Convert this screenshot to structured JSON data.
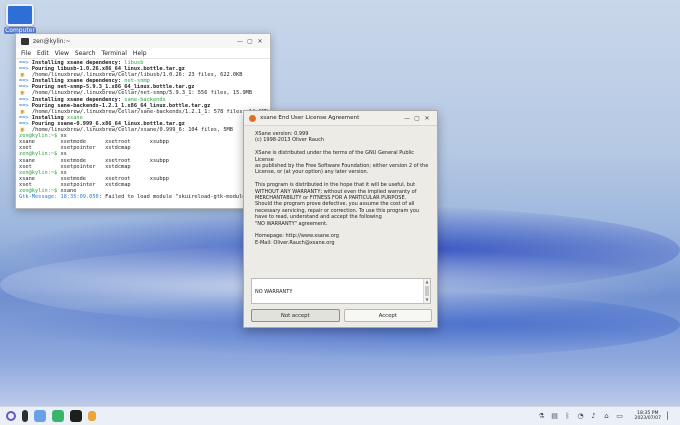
{
  "desktop": {
    "icon_label": "Computer"
  },
  "terminal": {
    "title": "zen@kylin:~",
    "menu": [
      "File",
      "Edit",
      "View",
      "Search",
      "Terminal",
      "Help"
    ],
    "lines": [
      [
        {
          "t": "==> ",
          "c": "arrow"
        },
        {
          "t": "Installing xsane dependency: ",
          "c": "bold"
        },
        {
          "t": "libusb",
          "c": "green"
        }
      ],
      [
        {
          "t": "==> ",
          "c": "arrow"
        },
        {
          "t": "Pouring libusb-1.0.26.x86_64_linux.bottle.tar.gz",
          "c": "bold"
        }
      ],
      [
        {
          "t": "🍺  ",
          "c": ""
        },
        {
          "t": "/home/linuxbrew/.linuxbrew/Cellar/libusb/1.0.26: 23 files, 622.0KB",
          "c": ""
        }
      ],
      [
        {
          "t": "==> ",
          "c": "arrow"
        },
        {
          "t": "Installing xsane dependency: ",
          "c": "bold"
        },
        {
          "t": "net-snmp",
          "c": "green"
        }
      ],
      [
        {
          "t": "==> ",
          "c": "arrow"
        },
        {
          "t": "Pouring net-snmp-5.9.3_1.x86_64_linux.bottle.tar.gz",
          "c": "bold"
        }
      ],
      [
        {
          "t": "🍺  ",
          "c": ""
        },
        {
          "t": "/home/linuxbrew/.linuxbrew/Cellar/net-snmp/5.9.3_1: 556 files, 15.9MB",
          "c": ""
        }
      ],
      [
        {
          "t": "==> ",
          "c": "arrow"
        },
        {
          "t": "Installing xsane dependency: ",
          "c": "bold"
        },
        {
          "t": "sane-backends",
          "c": "green"
        }
      ],
      [
        {
          "t": "==> ",
          "c": "arrow"
        },
        {
          "t": "Pouring sane-backends-1.2.1_1.x86_64_linux.bottle.tar.gz",
          "c": "bold"
        }
      ],
      [
        {
          "t": "🍺  ",
          "c": ""
        },
        {
          "t": "/home/linuxbrew/.linuxbrew/Cellar/sane-backends/1.2.1_1: 578 files, 14.1MB",
          "c": ""
        }
      ],
      [
        {
          "t": "==> ",
          "c": "arrow"
        },
        {
          "t": "Installing ",
          "c": "bold"
        },
        {
          "t": "xsane",
          "c": "green"
        }
      ],
      [
        {
          "t": "==> ",
          "c": "arrow"
        },
        {
          "t": "Pouring xsane-0.999_6.x86_64_linux.bottle.tar.gz",
          "c": "bold"
        }
      ],
      [
        {
          "t": "🍺  ",
          "c": ""
        },
        {
          "t": "/home/linuxbrew/.linuxbrew/Cellar/xsane/0.999_6: 104 files, 5MB",
          "c": ""
        }
      ],
      [
        {
          "t": "zen@kylin:~$ ",
          "c": "green"
        },
        {
          "t": "xs",
          "c": ""
        }
      ],
      [
        {
          "t": "xsane        xsetmode      xsetroot      xsubpp",
          "c": ""
        }
      ],
      [
        {
          "t": "xset         xsetpointer   xstdcmap",
          "c": ""
        }
      ],
      [
        {
          "t": "zen@kylin:~$ ",
          "c": "green"
        },
        {
          "t": "xs",
          "c": ""
        }
      ],
      [
        {
          "t": "xsane        xsetmode      xsetroot      xsubpp",
          "c": ""
        }
      ],
      [
        {
          "t": "xset         xsetpointer   xstdcmap",
          "c": ""
        }
      ],
      [
        {
          "t": "zen@kylin:~$ ",
          "c": "green"
        },
        {
          "t": "xs",
          "c": ""
        }
      ],
      [
        {
          "t": "xsane        xsetmode      xsetroot      xsubpp",
          "c": ""
        }
      ],
      [
        {
          "t": "xset         xsetpointer   xstdcmap",
          "c": ""
        }
      ],
      [
        {
          "t": "zen@kylin:~$ ",
          "c": "green"
        },
        {
          "t": "xsane",
          "c": ""
        }
      ],
      [
        {
          "t": "Gtk-Message: ",
          "c": "blue"
        },
        {
          "t": "18:35:09.050",
          "c": "blue"
        },
        {
          "t": ": Failed to load module \"skuireload-gtk-module\"",
          "c": ""
        }
      ]
    ]
  },
  "dialog": {
    "title": "xsane End User License Agreement",
    "paragraphs": [
      [
        "XSane version: 0.999",
        "(c) 1998-2013 Oliver Rauch"
      ],
      [
        "XSane is distributed under the terms of the GNU General Public License",
        "as published by the Free Software Foundation; either version 2 of the",
        "License, or (at your option) any later version."
      ],
      [
        "This program is distributed in the hope that it will be useful, but",
        "WITHOUT ANY WARRANTY; without even the implied warranty of",
        "MERCHANTABILITY or FITNESS FOR A PARTICULAR PURPOSE.",
        "Should the program prove defective, you assume the cost of all",
        "necessary servicing, repair or correction. To use this program you",
        "have to read, understand and accept the following",
        "\"NO WARRANTY\" agreement."
      ],
      [
        "Homepage: http://www.xsane.org",
        "E-Mail: Oliver.Rauch@xsane.org"
      ]
    ],
    "license_box_text": "NO WARRANTY",
    "buttons": {
      "reject": "Not accept",
      "accept": "Accept"
    }
  },
  "taskbar": {
    "time": "18:35 PM",
    "date": "2023/07/07"
  },
  "colors": {
    "accent": "#2b7bd1",
    "prompt": "#2aa33a",
    "dialog_bg": "#ecebe6"
  }
}
